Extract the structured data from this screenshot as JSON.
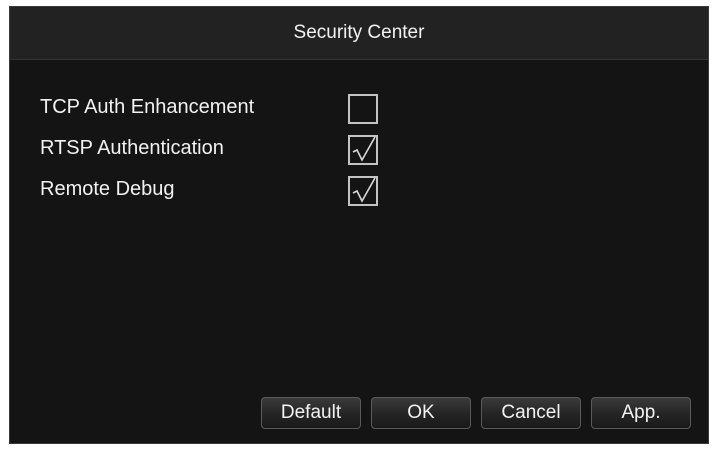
{
  "dialog": {
    "title": "Security Center"
  },
  "options": [
    {
      "label": "TCP Auth Enhancement",
      "checked": false
    },
    {
      "label": "RTSP Authentication",
      "checked": true
    },
    {
      "label": "Remote Debug",
      "checked": true
    }
  ],
  "buttons": {
    "default_label": "Default",
    "ok_label": "OK",
    "cancel_label": "Cancel",
    "apply_label": "App."
  },
  "icons": {
    "check": "check-icon"
  },
  "colors": {
    "background": "#141414",
    "title_bar": "#222222",
    "text": "#f2f2f2",
    "checkbox_border": "#c4c4c4"
  }
}
